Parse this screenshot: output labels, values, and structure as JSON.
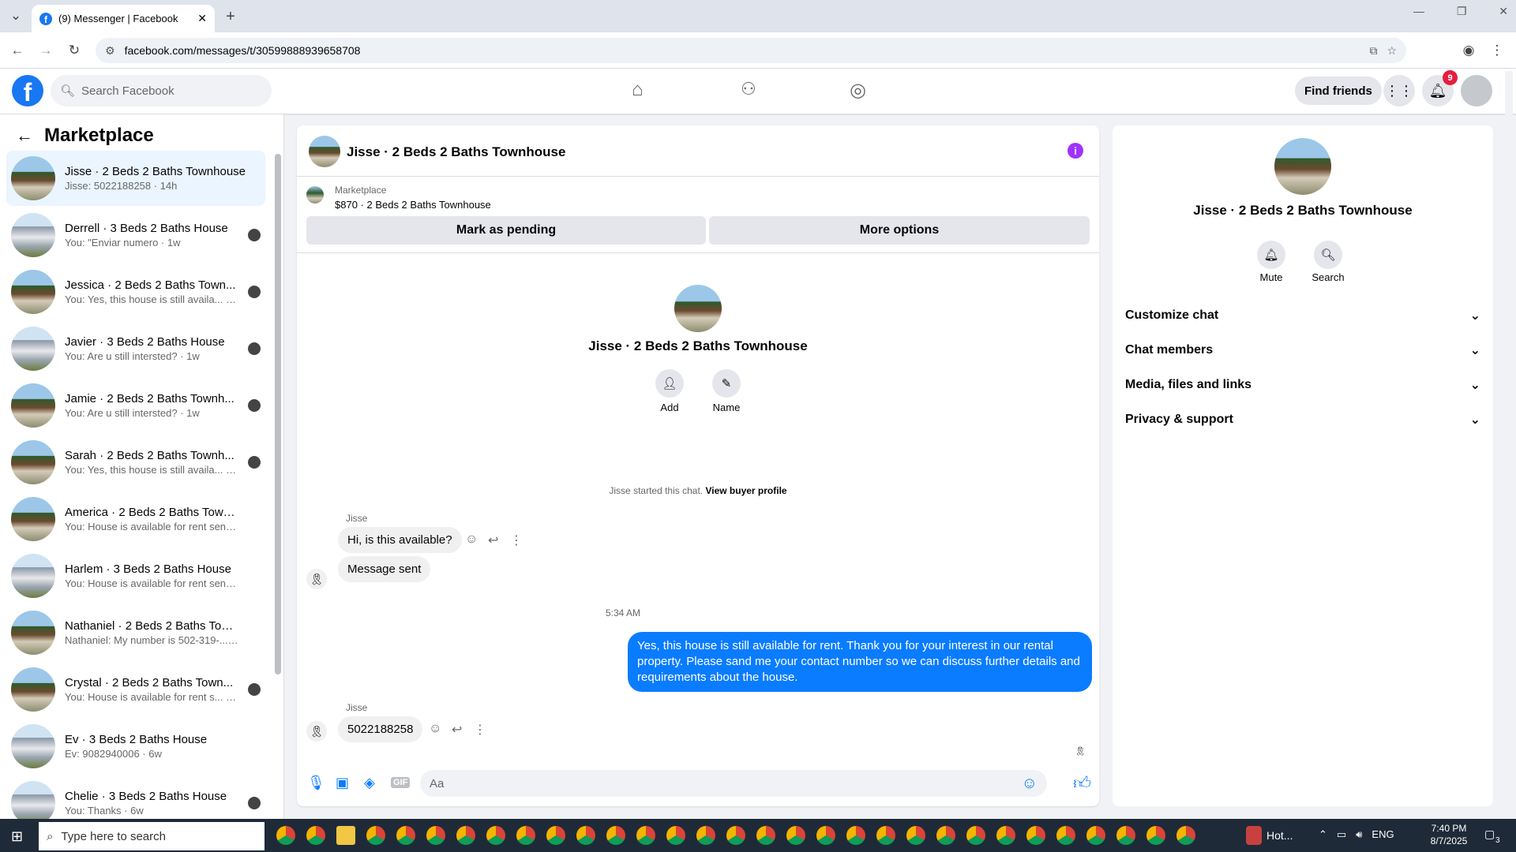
{
  "browser": {
    "tab_title": "(9) Messenger | Facebook",
    "url": "facebook.com/messages/t/30599888939658708",
    "new_tab": "+"
  },
  "fb": {
    "search_placeholder": "Search Facebook",
    "find_friends": "Find friends",
    "notif_count": "9"
  },
  "sidebar": {
    "title": "Marketplace",
    "conversations": [
      {
        "name": "Jisse · 2 Beds 2 Baths Townhouse",
        "snippet": "Jisse: 5022188258 · 14h"
      },
      {
        "name": "Derrell · 3 Beds 2 Baths House",
        "snippet": "You: \"Enviar numero · 1w"
      },
      {
        "name": "Jessica · 2 Beds 2 Baths Town...",
        "snippet": "You: Yes, this house is still availa...  1w"
      },
      {
        "name": "Javier · 3 Beds 2 Baths House",
        "snippet": "You: Are u still intersted? · 1w"
      },
      {
        "name": "Jamie · 2 Beds 2 Baths Townh...",
        "snippet": "You: Are u still intersted? · 1w"
      },
      {
        "name": "Sarah · 2 Beds 2 Baths Townh...",
        "snippet": "You: Yes, this house is still availa...  1w"
      },
      {
        "name": "America · 2 Beds 2 Baths Townh...",
        "snippet": "You: House is available for rent sen...  3w"
      },
      {
        "name": "Harlem · 3 Beds 2 Baths House",
        "snippet": "You: House is available for rent sen...  4w"
      },
      {
        "name": "Nathaniel · 2 Beds 2 Baths Town...",
        "snippet": "Nathaniel: My number is 502-319-...  5w"
      },
      {
        "name": "Crystal · 2 Beds 2 Baths Town...",
        "snippet": "You: House is available for rent s...  5w"
      },
      {
        "name": "Ev · 3 Beds 2 Baths House",
        "snippet": "Ev: 9082940006 · 6w"
      },
      {
        "name": "Chelie · 3 Beds 2 Baths House",
        "snippet": "You: Thanks · 6w"
      }
    ]
  },
  "chat": {
    "title": "Jisse · 2 Beds 2 Baths Townhouse",
    "listing_label": "Marketplace",
    "listing_price": "$870 · 2 Beds 2 Baths Townhouse",
    "mark_pending": "Mark as pending",
    "more_options": "More options",
    "profile_name": "Jisse · 2 Beds 2 Baths Townhouse",
    "add_label": "Add",
    "name_label": "Name",
    "started_text": "Jisse started this chat.",
    "view_buyer": "View buyer profile",
    "sender1": "Jisse",
    "msg1": "Hi, is this available?",
    "msg2": "Message sent",
    "time1": "5:34 AM",
    "msg_out": "Yes, this house is still available for rent. Thank you for your interest in our rental property. Please sand me your contact number so we can discuss further details and requirements about the house.",
    "sender2": "Jisse",
    "msg3": "5022188258",
    "input_placeholder": "Aa",
    "gif": "GIF"
  },
  "details": {
    "name": "Jisse · 2 Beds 2 Baths Townhouse",
    "mute": "Mute",
    "search": "Search",
    "sections": [
      "Customize chat",
      "Chat members",
      "Media, files and links",
      "Privacy & support"
    ]
  },
  "taskbar": {
    "search_placeholder": "Type here to search",
    "weather": "Hot...",
    "lang": "ENG",
    "time": "7:40 PM",
    "date": "8/7/2025",
    "notif": "3"
  },
  "colors": {
    "fb_blue": "#1877f2",
    "bubble_blue": "#0a7cff",
    "info_purple": "#a033ff"
  }
}
